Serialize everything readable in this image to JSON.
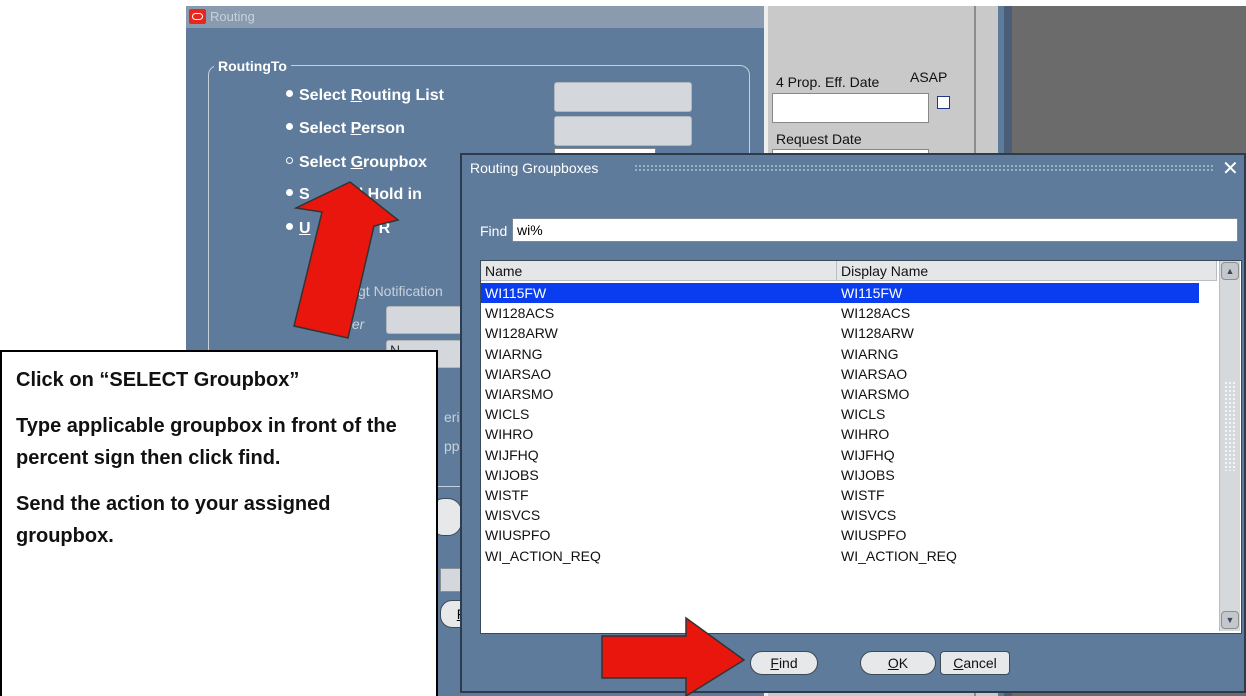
{
  "routing_window": {
    "title": "Routing",
    "group_label": "RoutingTo",
    "options": [
      {
        "pre": "Select ",
        "key": "R",
        "post": "outing List",
        "selected": false
      },
      {
        "pre": "Select ",
        "key": "P",
        "post": "erson",
        "selected": false
      },
      {
        "pre": "Select ",
        "key": "G",
        "post": "roupbox",
        "selected": true
      },
      {
        "pre": "S",
        "key": "",
        "post": "nd Hold in",
        "selected": false
      },
      {
        "pre": "U",
        "key": "",
        "post": "R",
        "selected": false
      }
    ],
    "partial_labels": {
      "notification": "gt Notification",
      "filter": "ter",
      "field_f": "F",
      "ering": "erin",
      "appro": "ppro",
      "n": "N"
    },
    "right_panel": {
      "prop_eff_date_label": "4 Prop. Eff. Date",
      "asap_label": "ASAP",
      "request_date_label": "Request Date"
    }
  },
  "dialog": {
    "title": "Routing Groupboxes",
    "find_label": "Find",
    "find_value": "wi%",
    "columns": [
      "Name",
      "Display Name"
    ],
    "rows": [
      {
        "name": "WI115FW",
        "display": "WI115FW",
        "selected": true
      },
      {
        "name": "WI128ACS",
        "display": "WI128ACS",
        "selected": false
      },
      {
        "name": "WI128ARW",
        "display": "WI128ARW",
        "selected": false
      },
      {
        "name": "WIARNG",
        "display": "WIARNG",
        "selected": false
      },
      {
        "name": "WIARSAO",
        "display": "WIARSAO",
        "selected": false
      },
      {
        "name": "WIARSMO",
        "display": "WIARSMO",
        "selected": false
      },
      {
        "name": "WICLS",
        "display": "WICLS",
        "selected": false
      },
      {
        "name": "WIHRO",
        "display": "WIHRO",
        "selected": false
      },
      {
        "name": "WIJFHQ",
        "display": "WIJFHQ",
        "selected": false
      },
      {
        "name": "WIJOBS",
        "display": "WIJOBS",
        "selected": false
      },
      {
        "name": "WISTF",
        "display": "WISTF",
        "selected": false
      },
      {
        "name": "WISVCS",
        "display": "WISVCS",
        "selected": false
      },
      {
        "name": "WIUSPFO",
        "display": "WIUSPFO",
        "selected": false
      },
      {
        "name": "WI_ACTION_REQ",
        "display": "WI_ACTION_REQ",
        "selected": false
      }
    ],
    "buttons": {
      "find": {
        "key": "F",
        "rest": "ind"
      },
      "ok": {
        "key": "O",
        "rest": "K"
      },
      "cancel": {
        "key": "C",
        "rest": "ancel"
      }
    },
    "close_icon": "close-icon"
  },
  "instructions": [
    "Click on “SELECT Groupbox”",
    "Type applicable groupbox in front of the percent sign then click find.",
    "Send the action to your assigned groupbox."
  ],
  "colors": {
    "window_bg": "#5e7b9c",
    "selection": "#0a3cf0",
    "arrow": "#e8160c"
  }
}
